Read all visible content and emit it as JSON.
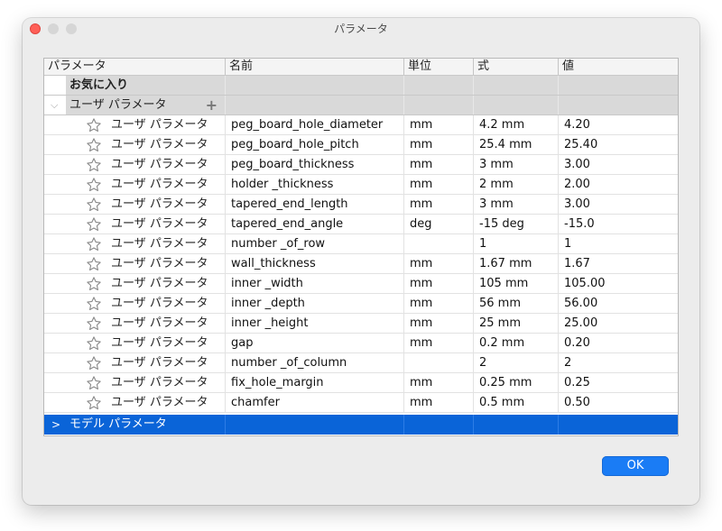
{
  "window": {
    "title": "パラメータ"
  },
  "columns": {
    "param": "パラメータ",
    "name": "名前",
    "unit": "単位",
    "expr": "式",
    "value": "値"
  },
  "groups": {
    "favorites": "お気に入り",
    "user": "ユーザ パラメータ",
    "model": "モデル パラメータ"
  },
  "rows": [
    {
      "type": "ユーザ パラメータ",
      "name": "peg_board_hole_diameter",
      "unit": "mm",
      "expr": "4.2 mm",
      "value": "4.20"
    },
    {
      "type": "ユーザ パラメータ",
      "name": "peg_board_hole_pitch",
      "unit": "mm",
      "expr": "25.4 mm",
      "value": "25.40"
    },
    {
      "type": "ユーザ パラメータ",
      "name": "peg_board_thickness",
      "unit": "mm",
      "expr": "3 mm",
      "value": "3.00"
    },
    {
      "type": "ユーザ パラメータ",
      "name": "holder _thickness",
      "unit": "mm",
      "expr": "2 mm",
      "value": "2.00"
    },
    {
      "type": "ユーザ パラメータ",
      "name": "tapered_end_length",
      "unit": "mm",
      "expr": "3 mm",
      "value": "3.00"
    },
    {
      "type": "ユーザ パラメータ",
      "name": "tapered_end_angle",
      "unit": "deg",
      "expr": "-15 deg",
      "value": "-15.0"
    },
    {
      "type": "ユーザ パラメータ",
      "name": "number _of_row",
      "unit": "",
      "expr": "1",
      "value": "1"
    },
    {
      "type": "ユーザ パラメータ",
      "name": "wall_thickness",
      "unit": "mm",
      "expr": "1.67 mm",
      "value": "1.67"
    },
    {
      "type": "ユーザ パラメータ",
      "name": "inner _width",
      "unit": "mm",
      "expr": "105 mm",
      "value": "105.00"
    },
    {
      "type": "ユーザ パラメータ",
      "name": "inner _depth",
      "unit": "mm",
      "expr": "56 mm",
      "value": "56.00"
    },
    {
      "type": "ユーザ パラメータ",
      "name": "inner _height",
      "unit": "mm",
      "expr": "25 mm",
      "value": "25.00"
    },
    {
      "type": "ユーザ パラメータ",
      "name": "gap",
      "unit": "mm",
      "expr": "0.2 mm",
      "value": "0.20"
    },
    {
      "type": "ユーザ パラメータ",
      "name": "number _of_column",
      "unit": "",
      "expr": "2",
      "value": "2"
    },
    {
      "type": "ユーザ パラメータ",
      "name": "fix_hole_margin",
      "unit": "mm",
      "expr": "0.25 mm",
      "value": "0.25"
    },
    {
      "type": "ユーザ パラメータ",
      "name": "chamfer",
      "unit": "mm",
      "expr": "0.5 mm",
      "value": "0.50"
    }
  ],
  "buttons": {
    "ok": "OK"
  },
  "icons": {
    "favorite": "star-outline-icon",
    "add": "plus-icon",
    "expanded": "chevron-down-icon",
    "collapsed": "chevron-right-icon"
  },
  "colors": {
    "selection": "#0a64d8",
    "ok_button": "#1a7cf5",
    "group_row": "#d9d9d9"
  }
}
